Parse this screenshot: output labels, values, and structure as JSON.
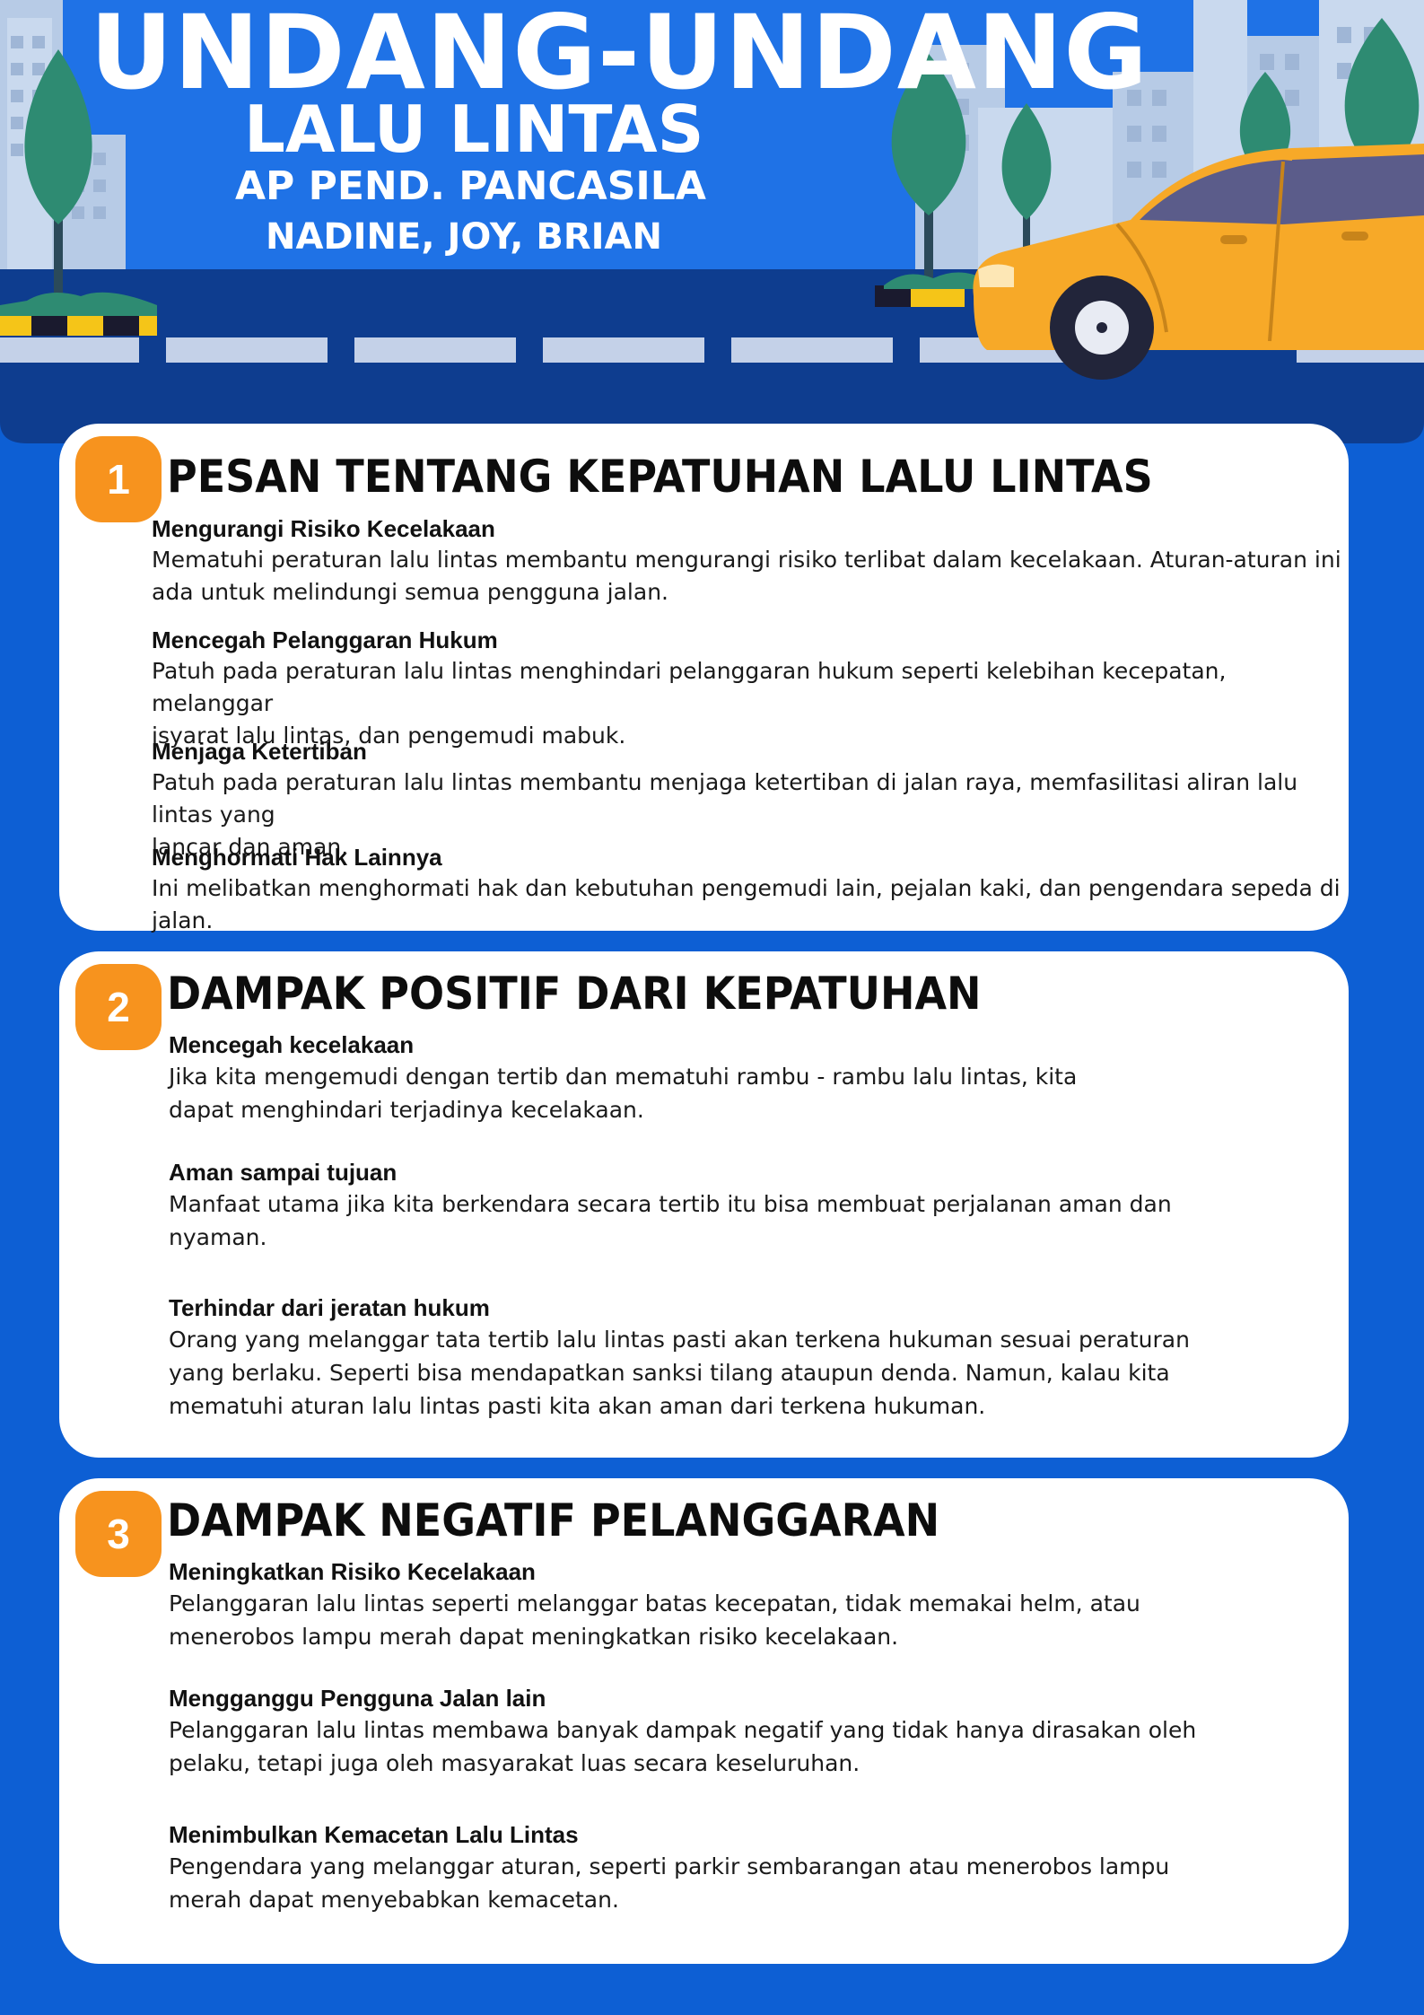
{
  "header": {
    "title_line1": "UNDANG-UNDANG",
    "title_line2": "LALU LINTAS",
    "subtitle": "AP PEND. PANCASILA",
    "authors": "NADINE, JOY, BRIAN"
  },
  "sections": [
    {
      "number": "1",
      "title": "PESAN TENTANG KEPATUHAN LALU LINTAS",
      "items": [
        {
          "title": "Mengurangi Risiko Kecelakaan",
          "lines": [
            "Mematuhi peraturan lalu lintas membantu mengurangi risiko terlibat dalam kecelakaan. Aturan-aturan ini",
            "ada untuk melindungi semua pengguna jalan."
          ]
        },
        {
          "title": "Mencegah Pelanggaran Hukum",
          "lines": [
            "Patuh pada peraturan lalu lintas menghindari pelanggaran hukum seperti kelebihan kecepatan, melanggar",
            "isyarat lalu lintas, dan pengemudi mabuk."
          ]
        },
        {
          "title": "Menjaga Ketertiban",
          "lines": [
            "Patuh pada peraturan lalu lintas membantu menjaga ketertiban di jalan raya, memfasilitasi aliran lalu lintas yang",
            "lancar dan aman."
          ]
        },
        {
          "title": "Menghormati Hak Lainnya",
          "lines": [
            "Ini melibatkan menghormati hak dan kebutuhan pengemudi lain, pejalan kaki, dan pengendara sepeda di jalan."
          ]
        }
      ]
    },
    {
      "number": "2",
      "title": "DAMPAK POSITIF DARI KEPATUHAN",
      "items": [
        {
          "title": "Mencegah kecelakaan",
          "lines": [
            "Jika kita mengemudi dengan tertib dan mematuhi rambu - rambu lalu lintas, kita",
            "dapat menghindari terjadinya kecelakaan."
          ]
        },
        {
          "title": "Aman sampai tujuan",
          "lines": [
            "Manfaat utama jika kita berkendara secara tertib itu bisa membuat perjalanan aman dan",
            "nyaman."
          ]
        },
        {
          "title": "Terhindar dari jeratan hukum",
          "lines": [
            "Orang yang melanggar tata tertib lalu lintas pasti akan terkena hukuman sesuai peraturan",
            "yang berlaku. Seperti bisa mendapatkan sanksi tilang ataupun denda. Namun, kalau kita",
            "mematuhi aturan lalu lintas pasti kita akan aman dari terkena hukuman."
          ]
        }
      ]
    },
    {
      "number": "3",
      "title": "DAMPAK NEGATIF PELANGGARAN",
      "items": [
        {
          "title": "Meningkatkan Risiko Kecelakaan",
          "lines": [
            "Pelanggaran lalu lintas seperti melanggar batas kecepatan, tidak memakai helm, atau",
            "menerobos lampu merah dapat meningkatkan risiko kecelakaan."
          ]
        },
        {
          "title": "Mengganggu Pengguna Jalan lain",
          "lines": [
            "Pelanggaran lalu lintas membawa banyak dampak negatif yang tidak hanya dirasakan oleh",
            "pelaku, tetapi juga oleh masyarakat luas secara keseluruhan."
          ]
        },
        {
          "title": "Menimbulkan Kemacetan Lalu Lintas",
          "lines": [
            "Pengendara yang melanggar aturan, seperti parkir sembarangan atau menerobos lampu",
            "merah dapat menyebabkan kemacetan."
          ]
        }
      ]
    }
  ],
  "colors": {
    "background": "#0d5fd4",
    "road": "#0e3d8f",
    "badge": "#f7931e",
    "car": "#f7a928"
  },
  "icons": [
    "tree-icon",
    "building-icon",
    "car-icon"
  ]
}
